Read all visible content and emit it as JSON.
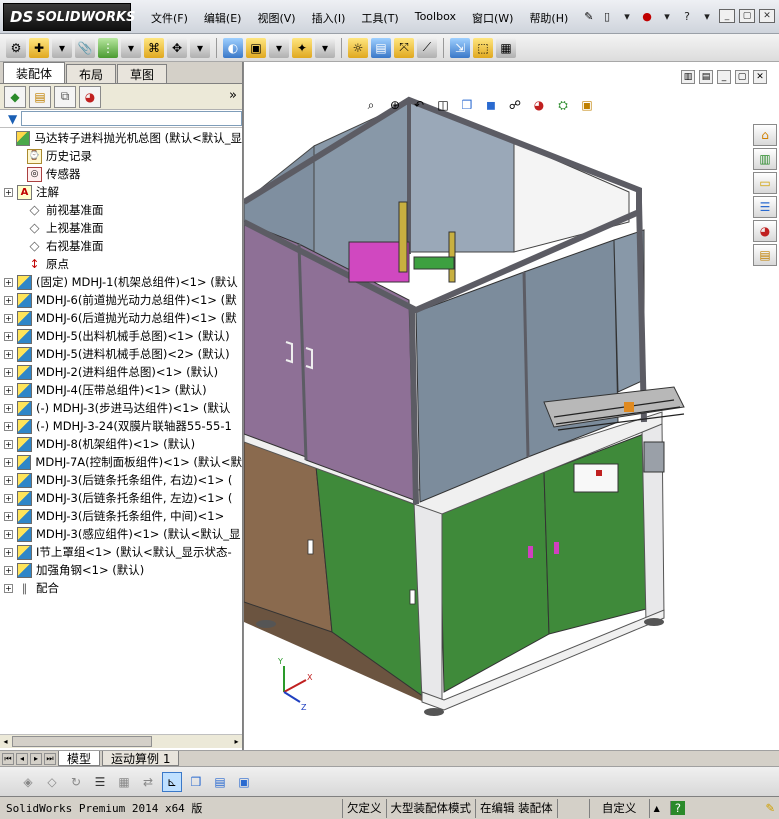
{
  "app": {
    "logo_ds": "DS",
    "logo_text": "SOLIDWORKS"
  },
  "menu": [
    {
      "label": "文件(F)"
    },
    {
      "label": "编辑(E)"
    },
    {
      "label": "视图(V)"
    },
    {
      "label": "插入(I)"
    },
    {
      "label": "工具(T)"
    },
    {
      "label": "Toolbox"
    },
    {
      "label": "窗口(W)"
    },
    {
      "label": "帮助(H)"
    }
  ],
  "command_tabs": [
    {
      "label": "装配体",
      "active": true
    },
    {
      "label": "布局",
      "active": false
    },
    {
      "label": "草图",
      "active": false
    }
  ],
  "feature_tree": {
    "more_symbol": "»",
    "filter_icon": "filter-icon",
    "items": [
      {
        "label": "马达转子进料抛光机总图  (默认<默认_显",
        "icon": "asm",
        "expander": "",
        "indent": 0
      },
      {
        "label": "历史记录",
        "icon": "hist",
        "expander": "",
        "indent": 1
      },
      {
        "label": "传感器",
        "icon": "sensor",
        "expander": "",
        "indent": 1
      },
      {
        "label": "注解",
        "icon": "note",
        "expander": "+",
        "indent": 1
      },
      {
        "label": "前视基准面",
        "icon": "plane",
        "expander": "",
        "indent": 1
      },
      {
        "label": "上视基准面",
        "icon": "plane",
        "expander": "",
        "indent": 1
      },
      {
        "label": "右视基准面",
        "icon": "plane",
        "expander": "",
        "indent": 1
      },
      {
        "label": "原点",
        "icon": "origin",
        "expander": "",
        "indent": 1
      },
      {
        "label": "(固定) MDHJ-1(机架总组件)<1> (默认",
        "icon": "sub",
        "expander": "+",
        "indent": 1
      },
      {
        "label": "MDHJ-6(前道抛光动力总组件)<1> (默",
        "icon": "sub",
        "expander": "+",
        "indent": 1
      },
      {
        "label": "MDHJ-6(后道抛光动力总组件)<1> (默",
        "icon": "sub",
        "expander": "+",
        "indent": 1
      },
      {
        "label": "MDHJ-5(出料机械手总图)<1> (默认)",
        "icon": "sub",
        "expander": "+",
        "indent": 1
      },
      {
        "label": "MDHJ-5(进料机械手总图)<2> (默认)",
        "icon": "sub",
        "expander": "+",
        "indent": 1
      },
      {
        "label": "MDHJ-2(进料组件总图)<1> (默认)",
        "icon": "sub",
        "expander": "+",
        "indent": 1
      },
      {
        "label": "MDHJ-4(压带总组件)<1> (默认)",
        "icon": "sub",
        "expander": "+",
        "indent": 1
      },
      {
        "label": "(-) MDHJ-3(步进马达组件)<1> (默认",
        "icon": "sub",
        "expander": "+",
        "indent": 1
      },
      {
        "label": "(-) MDHJ-3-24(双膜片联轴器55-55-1",
        "icon": "sub",
        "expander": "+",
        "indent": 1
      },
      {
        "label": "MDHJ-8(机架组件)<1> (默认)",
        "icon": "sub",
        "expander": "+",
        "indent": 1
      },
      {
        "label": "MDHJ-7A(控制面板组件)<1> (默认<默",
        "icon": "sub",
        "expander": "+",
        "indent": 1
      },
      {
        "label": "MDHJ-3(后链条托条组件, 右边)<1> (",
        "icon": "sub",
        "expander": "+",
        "indent": 1
      },
      {
        "label": "MDHJ-3(后链条托条组件, 左边)<1> (",
        "icon": "sub",
        "expander": "+",
        "indent": 1
      },
      {
        "label": "MDHJ-3(后链条托条组件, 中间)<1>",
        "icon": "sub",
        "expander": "+",
        "indent": 1
      },
      {
        "label": "MDHJ-3(感应组件)<1> (默认<默认_显",
        "icon": "sub",
        "expander": "+",
        "indent": 1
      },
      {
        "label": "I节上罩组<1> (默认<默认_显示状态-",
        "icon": "sub",
        "expander": "+",
        "indent": 1
      },
      {
        "label": "加强角钢<1> (默认)",
        "icon": "sub",
        "expander": "+",
        "indent": 1
      },
      {
        "label": "配合",
        "icon": "mate",
        "expander": "+",
        "indent": 1
      }
    ]
  },
  "bottom_tabs": [
    {
      "label": "模型",
      "active": true
    },
    {
      "label": "运动算例 1",
      "active": false
    }
  ],
  "status": {
    "left": "SolidWorks Premium 2014 x64 版",
    "cells": [
      "欠定义",
      "大型装配体模式",
      "在编辑 装配体",
      "",
      "自定义",
      "▲",
      "?"
    ]
  },
  "colors": {
    "door_purple": "#8e7096",
    "door_brown": "#8a6a4e",
    "door_green": "#3f8a3a",
    "frame_gray": "#7c7c84",
    "panel_slate": "#7f8fa0"
  }
}
